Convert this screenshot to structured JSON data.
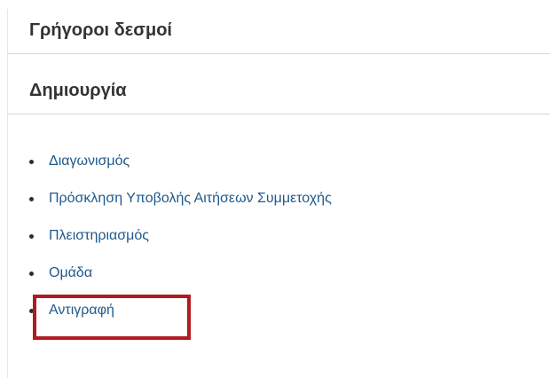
{
  "quick_links": {
    "title": "Γρήγοροι δεσμοί"
  },
  "create": {
    "title": "Δημιουργία",
    "items": [
      {
        "label": "Διαγωνισμός"
      },
      {
        "label": "Πρόσκληση Υποβολής Αιτήσεων Συμμετοχής"
      },
      {
        "label": "Πλειστηριασμός"
      },
      {
        "label": "Ομάδα"
      },
      {
        "label": "Αντιγραφή"
      }
    ]
  },
  "colors": {
    "link": "#20598c",
    "heading": "#333333",
    "highlight": "#b11b1f",
    "divider": "#cfd8df"
  }
}
